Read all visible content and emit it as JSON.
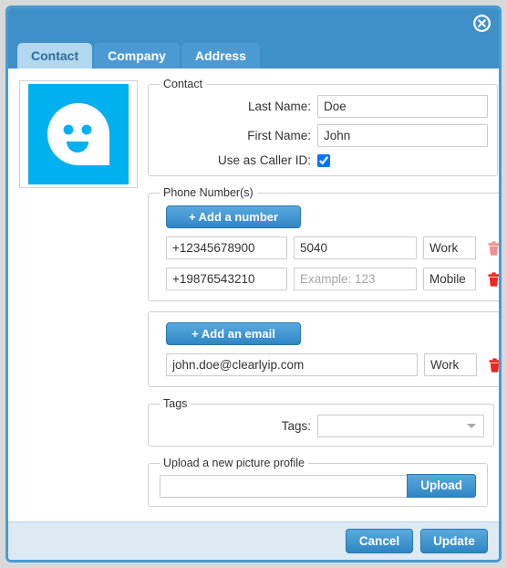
{
  "window": {
    "close_icon": "close-circle-icon",
    "accent_color": "#3f8fc9",
    "active_tab_color": "#b3d7ee",
    "avatar_color": "#00b0ef"
  },
  "tabs": [
    {
      "label": "Contact",
      "active": true
    },
    {
      "label": "Company",
      "active": false
    },
    {
      "label": "Address",
      "active": false
    }
  ],
  "avatar": {
    "icon": "ghost-face-avatar"
  },
  "contact_group": {
    "legend": "Contact",
    "last_name_label": "Last Name:",
    "last_name_value": "Doe",
    "first_name_label": "First Name:",
    "first_name_value": "John",
    "caller_id_label": "Use as Caller ID:",
    "caller_id_checked": true
  },
  "phone_group": {
    "legend": "Phone Number(s)",
    "add_button": "+  Add a number",
    "rows": [
      {
        "number": "+12345678900",
        "extension": "5040",
        "extension_placeholder": "Example: 123",
        "type": "Work",
        "delete_icon": "trash-icon",
        "delete_color": "#f19090"
      },
      {
        "number": "+19876543210",
        "extension": "",
        "extension_placeholder": "Example: 123",
        "type": "Mobile",
        "delete_icon": "trash-icon",
        "delete_color": "#e8291f"
      }
    ]
  },
  "email_group": {
    "add_button": "+  Add an email",
    "rows": [
      {
        "email": "john.doe@clearlyip.com",
        "type": "Work",
        "delete_icon": "trash-icon",
        "delete_color": "#e8291f"
      }
    ]
  },
  "tags_group": {
    "legend": "Tags",
    "label": "Tags:",
    "value": "",
    "caret_icon": "chevron-down-icon"
  },
  "upload_group": {
    "legend": "Upload a new picture profile",
    "value": "",
    "button": "Upload"
  },
  "footer": {
    "cancel": "Cancel",
    "update": "Update"
  }
}
